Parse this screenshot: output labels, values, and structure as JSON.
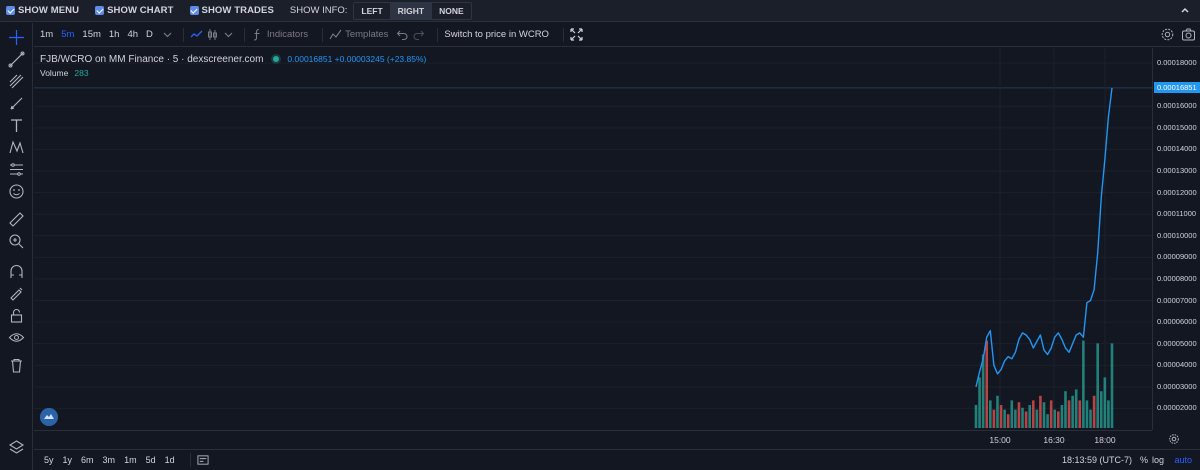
{
  "topbar": {
    "options": [
      {
        "label": "SHOW MENU",
        "checked": true
      },
      {
        "label": "SHOW CHART",
        "checked": true
      },
      {
        "label": "SHOW TRADES",
        "checked": true
      }
    ],
    "show_info_label": "SHOW INFO:",
    "show_info_options": [
      "LEFT",
      "RIGHT",
      "NONE"
    ],
    "show_info_selected": "RIGHT"
  },
  "toolbar": {
    "timeframes": [
      "1m",
      "5m",
      "15m",
      "1h",
      "4h",
      "D"
    ],
    "active_timeframe": "5m",
    "indicators_label": "Indicators",
    "templates_label": "Templates",
    "switch_label": "Switch to price in WCRO"
  },
  "legend": {
    "title": "FJB/WCRO on MM Finance · 5 · dexscreener.com",
    "price": "0.00016851 +0.00003245 (+23.85%)",
    "volume_label": "Volume",
    "volume_value": "283"
  },
  "price_axis": {
    "ticks": [
      "0.00018000",
      "0.00016000",
      "0.00015000",
      "0.00014000",
      "0.00013000",
      "0.00012000",
      "0.00011000",
      "0.00010000",
      "0.00009000",
      "0.00008000",
      "0.00007000",
      "0.00006000",
      "0.00005000",
      "0.00004000",
      "0.00003000",
      "0.00002000"
    ],
    "last_price": "0.00016851"
  },
  "time_axis": {
    "ticks": [
      "15:00",
      "16:30",
      "18:00"
    ]
  },
  "bottom": {
    "ranges": [
      "5y",
      "1y",
      "6m",
      "3m",
      "1m",
      "5d",
      "1d"
    ],
    "clock": "18:13:59 (UTC-7)",
    "percent_label": "%",
    "log_label": "log",
    "auto_label": "auto"
  },
  "colors": {
    "background": "#131722",
    "line": "#2196f3",
    "volume_up": "#26a69a",
    "volume_down": "#ef5350"
  },
  "chart_data": {
    "type": "line",
    "ylim": [
      1e-05,
      0.000187
    ],
    "x_ticks": [
      "15:00",
      "16:30",
      "18:00"
    ],
    "price_series": [
      3e-05,
      3.7e-05,
      4.3e-05,
      5.3e-05,
      5.6e-05,
      4e-05,
      3.6e-05,
      3.8e-05,
      4.2e-05,
      4.4e-05,
      4.3e-05,
      4.6e-05,
      5.2e-05,
      5.5e-05,
      5.4e-05,
      5.2e-05,
      4.8e-05,
      5.1e-05,
      5.4e-05,
      4.7e-05,
      4.5e-05,
      4.8e-05,
      5.3e-05,
      5.5e-05,
      5.2e-05,
      4.8e-05,
      4.6e-05,
      5e-05,
      5.4e-05,
      5.5e-05,
      5.3e-05,
      6.9e-05,
      7e-05,
      7.5e-05,
      9.2e-05,
      0.000118,
      0.000135,
      0.000155,
      0.0001685
    ],
    "volume_series": [
      {
        "v": 0.25,
        "up": true
      },
      {
        "v": 0.55,
        "up": true
      },
      {
        "v": 0.8,
        "up": true
      },
      {
        "v": 0.95,
        "up": false
      },
      {
        "v": 0.3,
        "up": true
      },
      {
        "v": 0.2,
        "up": false
      },
      {
        "v": 0.35,
        "up": true
      },
      {
        "v": 0.25,
        "up": false
      },
      {
        "v": 0.2,
        "up": true
      },
      {
        "v": 0.15,
        "up": false
      },
      {
        "v": 0.3,
        "up": true
      },
      {
        "v": 0.2,
        "up": true
      },
      {
        "v": 0.28,
        "up": false
      },
      {
        "v": 0.22,
        "up": true
      },
      {
        "v": 0.18,
        "up": false
      },
      {
        "v": 0.25,
        "up": true
      },
      {
        "v": 0.3,
        "up": false
      },
      {
        "v": 0.2,
        "up": true
      },
      {
        "v": 0.35,
        "up": false
      },
      {
        "v": 0.28,
        "up": true
      },
      {
        "v": 0.15,
        "up": true
      },
      {
        "v": 0.3,
        "up": false
      },
      {
        "v": 0.2,
        "up": true
      },
      {
        "v": 0.18,
        "up": false
      },
      {
        "v": 0.25,
        "up": true
      },
      {
        "v": 0.4,
        "up": true
      },
      {
        "v": 0.3,
        "up": false
      },
      {
        "v": 0.35,
        "up": true
      },
      {
        "v": 0.42,
        "up": true
      },
      {
        "v": 0.3,
        "up": false
      },
      {
        "v": 0.95,
        "up": true
      },
      {
        "v": 0.3,
        "up": true
      },
      {
        "v": 0.2,
        "up": true
      },
      {
        "v": 0.35,
        "up": false
      },
      {
        "v": 0.92,
        "up": true
      },
      {
        "v": 0.4,
        "up": true
      },
      {
        "v": 0.55,
        "up": true
      },
      {
        "v": 0.3,
        "up": true
      },
      {
        "v": 0.92,
        "up": true
      }
    ]
  }
}
